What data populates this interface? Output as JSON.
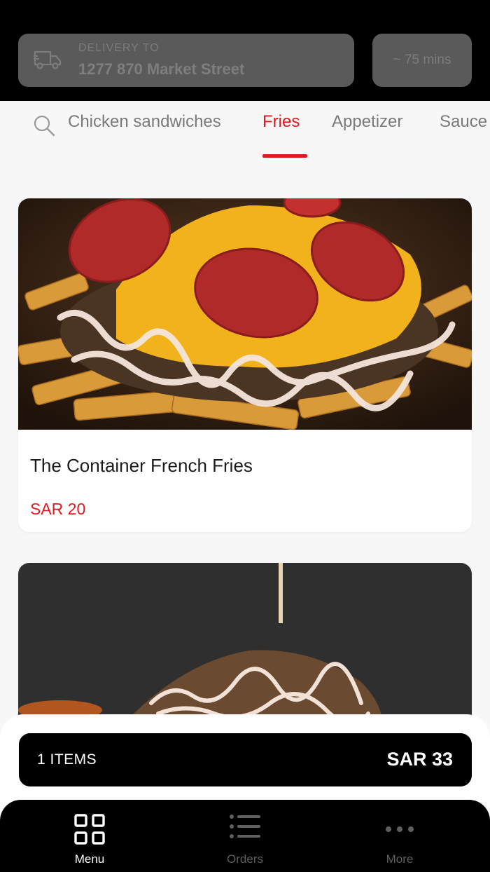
{
  "header": {
    "delivery_label": "DELIVERY TO",
    "delivery_address": "1277 870 Market Street",
    "eta": "~ 75 mins"
  },
  "tabs": [
    {
      "label": "Chicken sandwiches",
      "active": false
    },
    {
      "label": "Fries",
      "active": true
    },
    {
      "label": "Appetizer",
      "active": false
    },
    {
      "label": "Sauce",
      "active": false
    }
  ],
  "products": [
    {
      "name": "The Container French Fries",
      "price": "SAR 20"
    }
  ],
  "cart": {
    "items_label": "1 ITEMS",
    "total": "SAR 33"
  },
  "nav": {
    "menu": "Menu",
    "orders": "Orders",
    "more": "More"
  },
  "colors": {
    "accent": "#e0191e",
    "header_bg": "#000000",
    "nav_inactive": "#5f5f5f"
  }
}
